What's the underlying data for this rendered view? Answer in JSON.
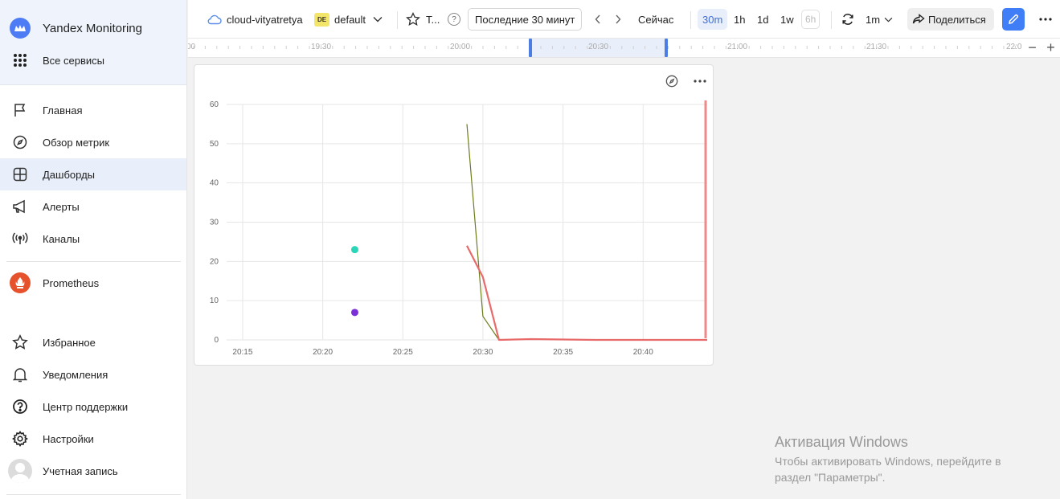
{
  "sidebar": {
    "brand": "Yandex Monitoring",
    "all_services": "Все сервисы",
    "nav": [
      {
        "label": "Главная",
        "icon": "flag-icon"
      },
      {
        "label": "Обзор метрик",
        "icon": "compass-icon"
      },
      {
        "label": "Дашборды",
        "icon": "dashboard-icon",
        "active": true
      },
      {
        "label": "Алерты",
        "icon": "megaphone-icon"
      },
      {
        "label": "Каналы",
        "icon": "broadcast-icon"
      }
    ],
    "prometheus": "Prometheus",
    "bottom": [
      {
        "label": "Избранное",
        "icon": "star-icon"
      },
      {
        "label": "Уведомления",
        "icon": "bell-icon"
      },
      {
        "label": "Центр поддержки",
        "icon": "help-icon"
      },
      {
        "label": "Настройки",
        "icon": "gear-icon"
      },
      {
        "label": "Учетная запись",
        "icon": "avatar"
      }
    ]
  },
  "topbar": {
    "cloud": "cloud-vityatretya",
    "folder_badge": "DE",
    "folder": "default",
    "dashboard_title": "T...",
    "help": "?",
    "range": "Последние 30 минут",
    "now": "Сейчас",
    "presets": [
      "30m",
      "1h",
      "1d",
      "1w",
      "6h"
    ],
    "active_preset": "30m",
    "refresh_interval": "1m",
    "share": "Поделиться"
  },
  "ruler": {
    "labels": [
      "19:30",
      "20:00",
      "20:30",
      "21:00",
      "21:30",
      "22:0"
    ],
    "left_cut": "00",
    "zoom_out": "−",
    "zoom_in": "+"
  },
  "chart_data": {
    "type": "line",
    "x_ticks": [
      "20:15",
      "20:20",
      "20:25",
      "20:30",
      "20:35",
      "20:40"
    ],
    "y_ticks": [
      0,
      10,
      20,
      30,
      40,
      50,
      60
    ],
    "ylim": [
      0,
      60
    ],
    "xlim_minutes": [
      "20:14",
      "20:44"
    ],
    "grid": true,
    "series": [
      {
        "color": "#6b7d1a",
        "points": [
          [
            "20:29",
            55
          ],
          [
            "20:30",
            6
          ],
          [
            "20:31",
            0
          ],
          [
            "20:33",
            0.2
          ],
          [
            "20:35",
            0.1
          ],
          [
            "20:37",
            0
          ],
          [
            "20:44",
            0
          ]
        ]
      },
      {
        "color": "#e86a6a",
        "points": [
          [
            "20:29",
            24
          ],
          [
            "20:30",
            16
          ],
          [
            "20:31",
            0
          ],
          [
            "20:33",
            0.2
          ],
          [
            "20:35",
            0.1
          ],
          [
            "20:37",
            0
          ],
          [
            "20:44",
            0
          ]
        ]
      },
      {
        "color": "#2bd6b8",
        "points": [
          [
            "20:22",
            23
          ]
        ]
      },
      {
        "color": "#7b2fd6",
        "points": [
          [
            "20:22",
            7
          ]
        ]
      }
    ],
    "marker": {
      "x": "20:44",
      "color": "#f08a8a"
    }
  },
  "watermark": {
    "title": "Активация Windows",
    "line1": "Чтобы активировать Windows, перейдите в",
    "line2": "раздел \"Параметры\"."
  }
}
